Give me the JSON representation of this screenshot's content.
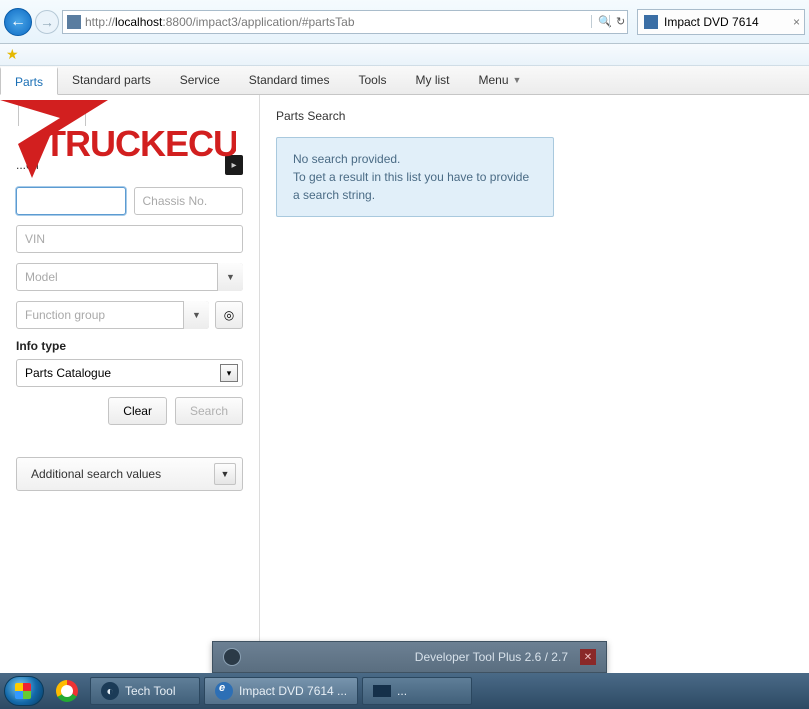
{
  "browser": {
    "url_prefix": "http://",
    "url_host": "localhost",
    "url_path": ":8800/impact3/application/#partsTab",
    "tab_title": "Impact DVD 7614"
  },
  "nav": {
    "parts": "Parts",
    "standard_parts": "Standard parts",
    "service": "Service",
    "standard_times": "Standard times",
    "tools": "Tools",
    "my_list": "My list",
    "menu": "Menu"
  },
  "sidebar": {
    "search_label": "...ch",
    "chassis_ph": "Chassis No.",
    "vin_ph": "VIN",
    "model_ph": "Model",
    "fgroup_ph": "Function group",
    "info_type_label": "Info type",
    "info_type_value": "Parts Catalogue",
    "clear": "Clear",
    "search": "Search",
    "additional": "Additional search values"
  },
  "main": {
    "title": "Parts Search",
    "msg1": "No search provided.",
    "msg2": "To get a result in this list you have to provide a search string."
  },
  "watermark": "TRUCKECU",
  "devbadge": "Developer Tool Plus 2.6 / 2.7",
  "taskbar": {
    "techtool": "Tech Tool",
    "impact": "Impact DVD 7614 ..."
  }
}
